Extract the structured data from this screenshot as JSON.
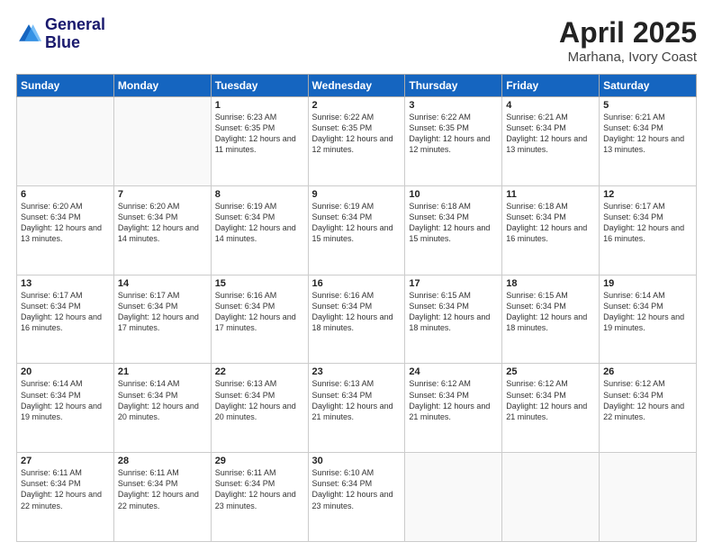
{
  "header": {
    "logo_line1": "General",
    "logo_line2": "Blue",
    "title": "April 2025",
    "subtitle": "Marhana, Ivory Coast"
  },
  "weekdays": [
    "Sunday",
    "Monday",
    "Tuesday",
    "Wednesday",
    "Thursday",
    "Friday",
    "Saturday"
  ],
  "weeks": [
    [
      {
        "day": "",
        "info": ""
      },
      {
        "day": "",
        "info": ""
      },
      {
        "day": "1",
        "info": "Sunrise: 6:23 AM\nSunset: 6:35 PM\nDaylight: 12 hours and 11 minutes."
      },
      {
        "day": "2",
        "info": "Sunrise: 6:22 AM\nSunset: 6:35 PM\nDaylight: 12 hours and 12 minutes."
      },
      {
        "day": "3",
        "info": "Sunrise: 6:22 AM\nSunset: 6:35 PM\nDaylight: 12 hours and 12 minutes."
      },
      {
        "day": "4",
        "info": "Sunrise: 6:21 AM\nSunset: 6:34 PM\nDaylight: 12 hours and 13 minutes."
      },
      {
        "day": "5",
        "info": "Sunrise: 6:21 AM\nSunset: 6:34 PM\nDaylight: 12 hours and 13 minutes."
      }
    ],
    [
      {
        "day": "6",
        "info": "Sunrise: 6:20 AM\nSunset: 6:34 PM\nDaylight: 12 hours and 13 minutes."
      },
      {
        "day": "7",
        "info": "Sunrise: 6:20 AM\nSunset: 6:34 PM\nDaylight: 12 hours and 14 minutes."
      },
      {
        "day": "8",
        "info": "Sunrise: 6:19 AM\nSunset: 6:34 PM\nDaylight: 12 hours and 14 minutes."
      },
      {
        "day": "9",
        "info": "Sunrise: 6:19 AM\nSunset: 6:34 PM\nDaylight: 12 hours and 15 minutes."
      },
      {
        "day": "10",
        "info": "Sunrise: 6:18 AM\nSunset: 6:34 PM\nDaylight: 12 hours and 15 minutes."
      },
      {
        "day": "11",
        "info": "Sunrise: 6:18 AM\nSunset: 6:34 PM\nDaylight: 12 hours and 16 minutes."
      },
      {
        "day": "12",
        "info": "Sunrise: 6:17 AM\nSunset: 6:34 PM\nDaylight: 12 hours and 16 minutes."
      }
    ],
    [
      {
        "day": "13",
        "info": "Sunrise: 6:17 AM\nSunset: 6:34 PM\nDaylight: 12 hours and 16 minutes."
      },
      {
        "day": "14",
        "info": "Sunrise: 6:17 AM\nSunset: 6:34 PM\nDaylight: 12 hours and 17 minutes."
      },
      {
        "day": "15",
        "info": "Sunrise: 6:16 AM\nSunset: 6:34 PM\nDaylight: 12 hours and 17 minutes."
      },
      {
        "day": "16",
        "info": "Sunrise: 6:16 AM\nSunset: 6:34 PM\nDaylight: 12 hours and 18 minutes."
      },
      {
        "day": "17",
        "info": "Sunrise: 6:15 AM\nSunset: 6:34 PM\nDaylight: 12 hours and 18 minutes."
      },
      {
        "day": "18",
        "info": "Sunrise: 6:15 AM\nSunset: 6:34 PM\nDaylight: 12 hours and 18 minutes."
      },
      {
        "day": "19",
        "info": "Sunrise: 6:14 AM\nSunset: 6:34 PM\nDaylight: 12 hours and 19 minutes."
      }
    ],
    [
      {
        "day": "20",
        "info": "Sunrise: 6:14 AM\nSunset: 6:34 PM\nDaylight: 12 hours and 19 minutes."
      },
      {
        "day": "21",
        "info": "Sunrise: 6:14 AM\nSunset: 6:34 PM\nDaylight: 12 hours and 20 minutes."
      },
      {
        "day": "22",
        "info": "Sunrise: 6:13 AM\nSunset: 6:34 PM\nDaylight: 12 hours and 20 minutes."
      },
      {
        "day": "23",
        "info": "Sunrise: 6:13 AM\nSunset: 6:34 PM\nDaylight: 12 hours and 21 minutes."
      },
      {
        "day": "24",
        "info": "Sunrise: 6:12 AM\nSunset: 6:34 PM\nDaylight: 12 hours and 21 minutes."
      },
      {
        "day": "25",
        "info": "Sunrise: 6:12 AM\nSunset: 6:34 PM\nDaylight: 12 hours and 21 minutes."
      },
      {
        "day": "26",
        "info": "Sunrise: 6:12 AM\nSunset: 6:34 PM\nDaylight: 12 hours and 22 minutes."
      }
    ],
    [
      {
        "day": "27",
        "info": "Sunrise: 6:11 AM\nSunset: 6:34 PM\nDaylight: 12 hours and 22 minutes."
      },
      {
        "day": "28",
        "info": "Sunrise: 6:11 AM\nSunset: 6:34 PM\nDaylight: 12 hours and 22 minutes."
      },
      {
        "day": "29",
        "info": "Sunrise: 6:11 AM\nSunset: 6:34 PM\nDaylight: 12 hours and 23 minutes."
      },
      {
        "day": "30",
        "info": "Sunrise: 6:10 AM\nSunset: 6:34 PM\nDaylight: 12 hours and 23 minutes."
      },
      {
        "day": "",
        "info": ""
      },
      {
        "day": "",
        "info": ""
      },
      {
        "day": "",
        "info": ""
      }
    ]
  ]
}
